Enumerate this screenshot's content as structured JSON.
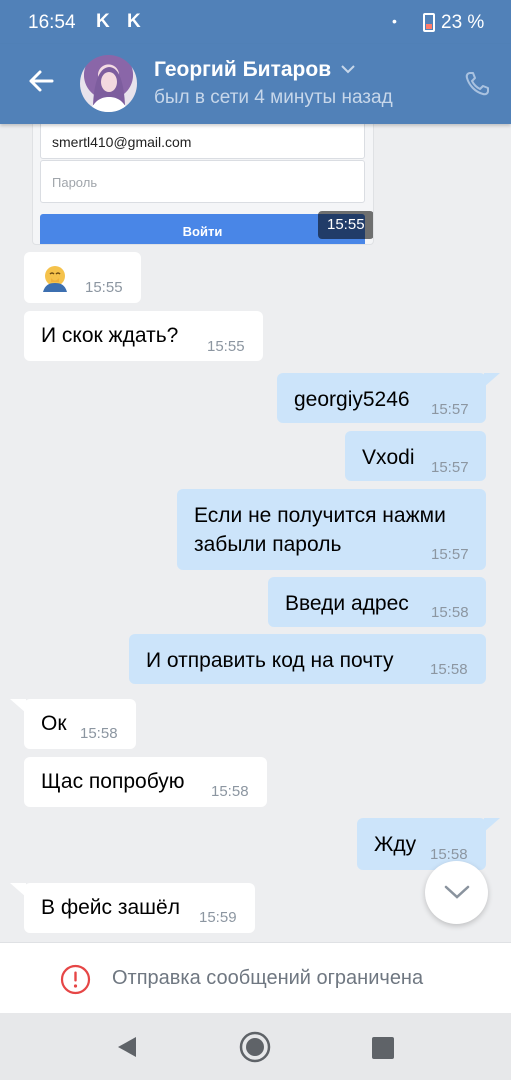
{
  "status_bar": {
    "time": "16:54",
    "notification_icons": [
      "K",
      "K"
    ],
    "dot": "•",
    "battery_percent": "23 %",
    "battery_level": 0.23
  },
  "header": {
    "contact_name": "Георгий Битаров",
    "last_seen": "был в сети 4 минуты назад",
    "icons": [
      "back-arrow-icon",
      "chevron-down-icon",
      "phone-icon"
    ]
  },
  "screenshot_attachment": {
    "email_value": "smertl410@gmail.com",
    "password_placeholder": "Пароль",
    "login_button": "Войти",
    "time": "15:55"
  },
  "messages": [
    {
      "dir": "in",
      "emoji": "face-with-hand-over-mouth-emoji",
      "time": "15:55"
    },
    {
      "dir": "in",
      "text": "И скок ждать?",
      "time": "15:55"
    },
    {
      "dir": "out",
      "text": "georgiy5246",
      "time": "15:57"
    },
    {
      "dir": "out",
      "text": "Vxodi",
      "time": "15:57"
    },
    {
      "dir": "out",
      "line1": "Если не получится нажми",
      "line2": "забыли пароль",
      "time": "15:57"
    },
    {
      "dir": "out",
      "text": "Введи адрес",
      "time": "15:58"
    },
    {
      "dir": "out",
      "text": "И отправить код на почту",
      "time": "15:58"
    },
    {
      "dir": "in",
      "text": "Ок",
      "time": "15:58"
    },
    {
      "dir": "in",
      "text": "Щас попробую",
      "time": "15:58"
    },
    {
      "dir": "out",
      "text": "Жду",
      "time": "15:58"
    },
    {
      "dir": "in",
      "text": "В фейс зашёл",
      "time": "15:59"
    }
  ],
  "restriction_bar": {
    "text": "Отправка сообщений ограничена",
    "icon": "warning-circle-icon",
    "color": "#e64646"
  },
  "colors": {
    "header_bg": "#5181b8",
    "incoming_bubble": "#ffffff",
    "outgoing_bubble": "#cce4fa",
    "chat_bg": "#edeef0"
  },
  "nav_bar": {
    "icons": [
      "nav-back-icon",
      "nav-home-icon",
      "nav-recents-icon"
    ]
  }
}
